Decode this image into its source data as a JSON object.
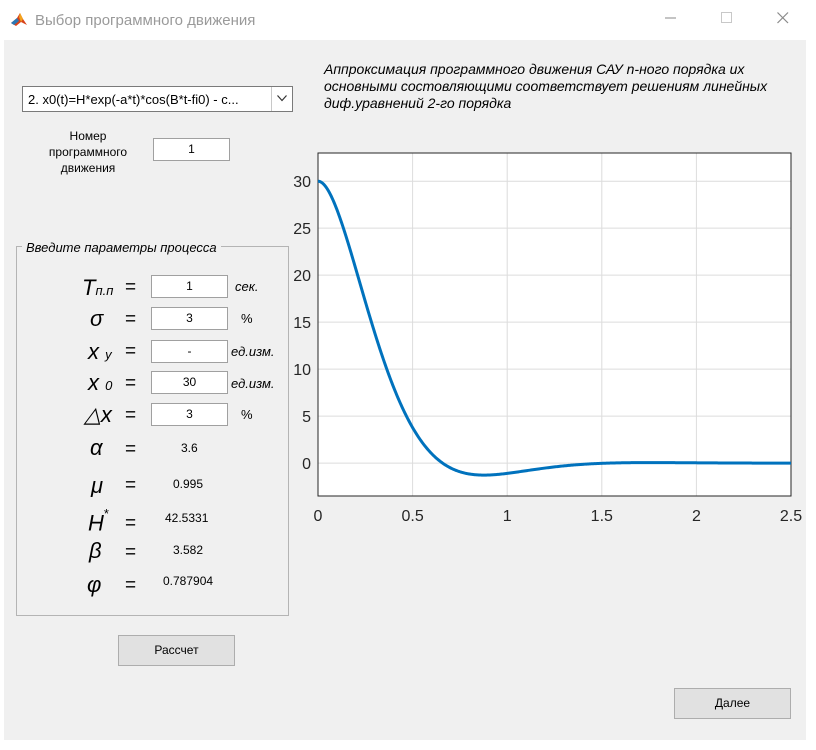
{
  "window": {
    "title": "Выбор программного движения",
    "controls": [
      "minimize",
      "maximize",
      "close"
    ]
  },
  "motion_select": {
    "selected": "2. x0(t)=H*exp(-a*t)*cos(B*t-fi0) - с..."
  },
  "motion_number": {
    "label_lines": [
      "Номер",
      "программного",
      "движения"
    ],
    "value": "1"
  },
  "params": {
    "title": "Введите параметры процесса",
    "rows": [
      {
        "symbol": "T",
        "sub": "п.п",
        "eq": "=",
        "value": "1",
        "unit": "сек."
      },
      {
        "symbol": "σ",
        "sub": "",
        "eq": "=",
        "value": "3",
        "unit": "%"
      },
      {
        "symbol": "x",
        "sub": "у",
        "eq": "=",
        "value": "-",
        "unit": "ед.изм."
      },
      {
        "symbol": "x",
        "sub": "0",
        "eq": "=",
        "value": "30",
        "unit": "ед.изм."
      },
      {
        "symbol": "△x",
        "sub": "",
        "eq": "=",
        "value": "3",
        "unit": "%"
      }
    ],
    "results": [
      {
        "symbol": "α",
        "eq": "=",
        "value": "3.6"
      },
      {
        "symbol": "μ",
        "eq": "=",
        "value": "0.995"
      },
      {
        "symbol": "H",
        "sup": "*",
        "eq": "=",
        "value": "42.5331"
      },
      {
        "symbol": "β",
        "eq": "=",
        "value": "3.582"
      },
      {
        "symbol": "φ",
        "eq": "=",
        "value": "0.787904"
      }
    ]
  },
  "buttons": {
    "calculate": "Рассчет",
    "next": "Далее"
  },
  "heading": "Аппроксимация программного движения САУ n-ного порядка их основными состовляющими соответствует решениям линейных диф.уравнений 2-го порядка",
  "colors": {
    "line": "#0072bd",
    "grid": "#dcdcdc",
    "background": "#f0f0f0"
  },
  "chart_data": {
    "type": "line",
    "title": "",
    "xlabel": "",
    "ylabel": "",
    "xlim": [
      0,
      2.5
    ],
    "ylim": [
      -3.5,
      33
    ],
    "xticks": [
      0,
      0.5,
      1,
      1.5,
      2,
      2.5
    ],
    "yticks": [
      0,
      5,
      10,
      15,
      20,
      25,
      30
    ],
    "xtick_labels": [
      "0",
      "0.5",
      "1",
      "1.5",
      "2",
      "2.5"
    ],
    "ytick_labels": [
      "0",
      "5",
      "10",
      "15",
      "20",
      "25",
      "30"
    ],
    "grid": true,
    "series": [
      {
        "formula": "H*exp(-a*t)*cos(B*t-fi0)",
        "params": {
          "H": 42.5331,
          "a": 3.6,
          "B": 3.582,
          "fi0": 0.787904
        },
        "x_range": [
          0,
          2.5
        ]
      }
    ]
  }
}
